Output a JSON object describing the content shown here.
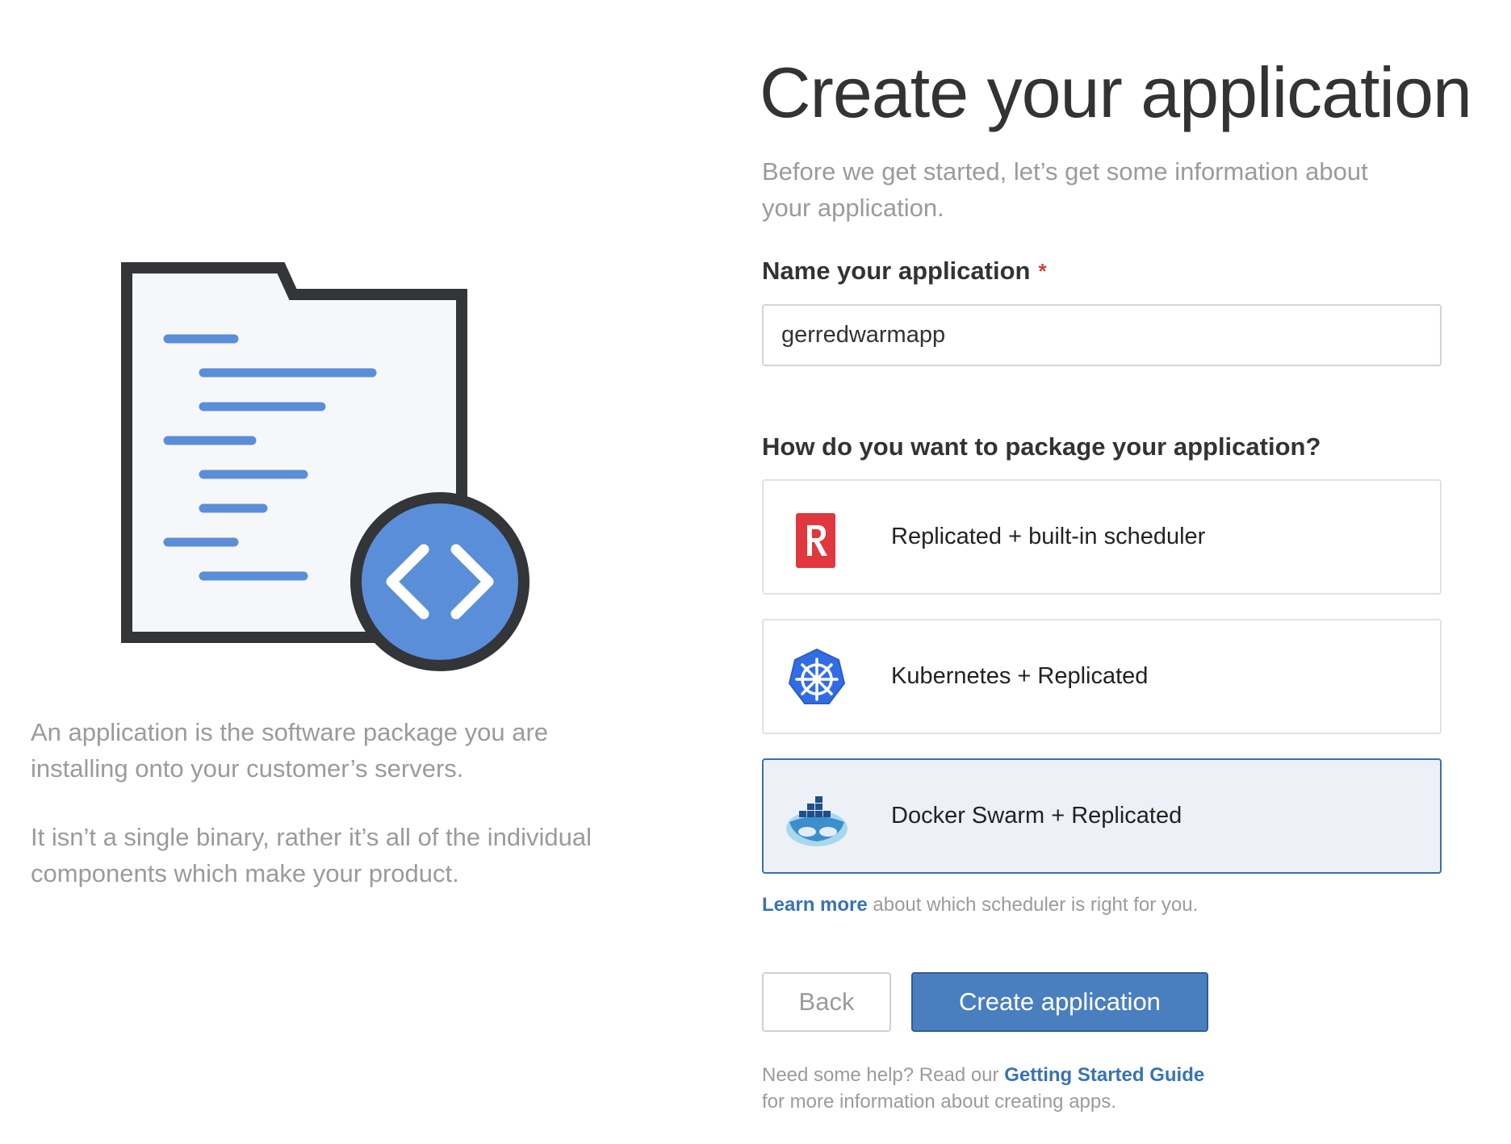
{
  "left": {
    "paragraph_1": "An application is the software package you are installing onto your customer’s servers.",
    "paragraph_2": "It isn’t a single binary, rather it’s all of the individual components which make your product.",
    "illustration_icon": "folder-code-icon"
  },
  "form": {
    "title": "Create your application",
    "subtitle": "Before we get started, let’s get some information about your application.",
    "name_label": "Name your application",
    "required_marker": "*",
    "name_value": "gerredwarmapp",
    "package_label": "How do you want to package your application?",
    "options": [
      {
        "label": "Replicated + built-in scheduler",
        "icon": "replicated-logo-icon",
        "selected": false
      },
      {
        "label": "Kubernetes + Replicated",
        "icon": "kubernetes-logo-icon",
        "selected": false
      },
      {
        "label": "Docker Swarm + Replicated",
        "icon": "docker-swarm-logo-icon",
        "selected": true
      }
    ],
    "learn_more_link": "Learn more",
    "learn_more_rest": " about which scheduler is right for you.",
    "back_label": "Back",
    "create_label": "Create application",
    "help_prefix": "Need some help? Read our ",
    "help_link": "Getting Started Guide",
    "help_suffix": "for more information about creating apps."
  },
  "colors": {
    "accent": "#4a7fbf",
    "link": "#3873b5",
    "selected_background": "#edf1f7",
    "selected_border": "#3c6fa8",
    "muted_text": "#9b9b9b",
    "required": "#d0453b",
    "replicated_red": "#e0383e",
    "kubernetes_blue": "#326ce5"
  }
}
